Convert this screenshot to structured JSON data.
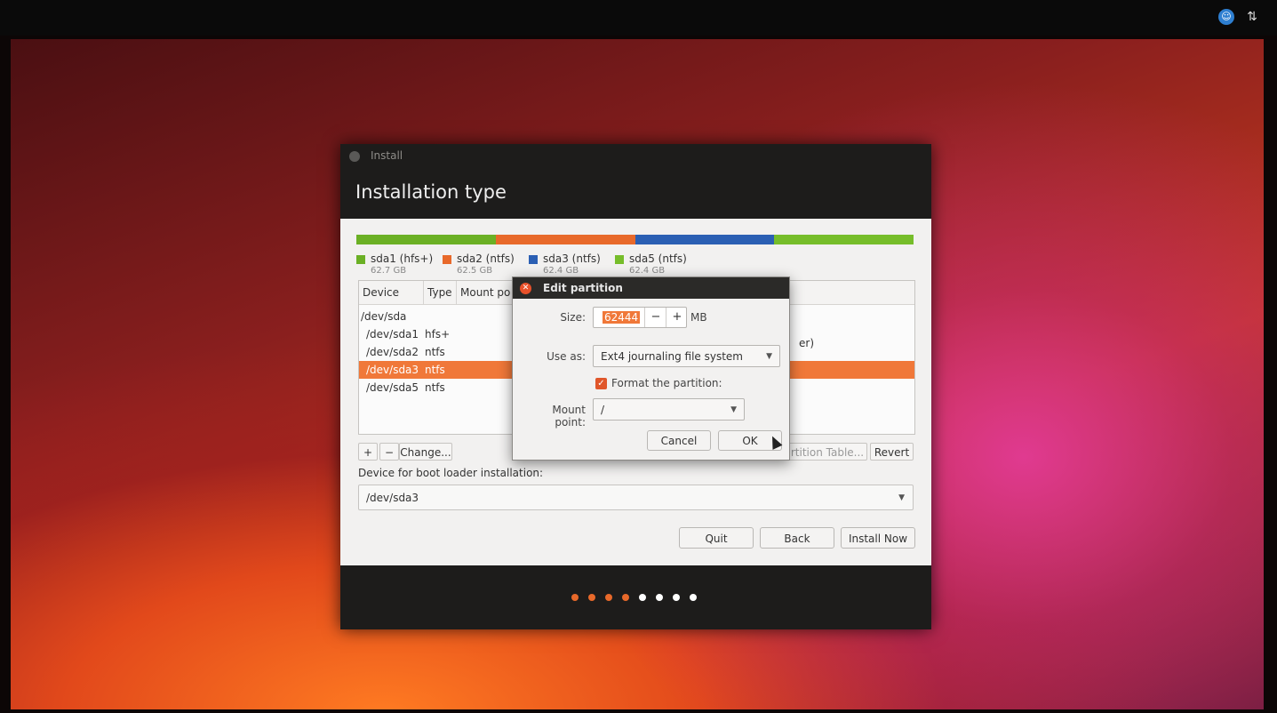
{
  "window": {
    "title": "Install",
    "page_title": "Installation type"
  },
  "partitions_bar": [
    {
      "name": "sda1 (hfs+)",
      "size": "62.7 GB",
      "color": "#6bb025"
    },
    {
      "name": "sda2 (ntfs)",
      "size": "62.5 GB",
      "color": "#e8692a"
    },
    {
      "name": "sda3 (ntfs)",
      "size": "62.4 GB",
      "color": "#2b5fb3"
    },
    {
      "name": "sda5 (ntfs)",
      "size": "62.4 GB",
      "color": "#76bd2a"
    }
  ],
  "table": {
    "headers": [
      "Device",
      "Type",
      "Mount po"
    ],
    "rows": [
      {
        "device": "/dev/sda",
        "type": ""
      },
      {
        "device": "/dev/sda1",
        "type": "hfs+"
      },
      {
        "device": "/dev/sda2",
        "type": "ntfs"
      },
      {
        "device": "/dev/sda3",
        "type": "ntfs",
        "selected": true
      },
      {
        "device": "/dev/sda5",
        "type": "ntfs"
      }
    ],
    "partial_text": "er)"
  },
  "table_buttons": {
    "add": "+",
    "remove": "−",
    "change": "Change...",
    "new_table": "rtition Table...",
    "revert": "Revert"
  },
  "boot_loader": {
    "label": "Device for boot loader installation:",
    "value": "/dev/sda3"
  },
  "buttons": {
    "quit": "Quit",
    "back": "Back",
    "install": "Install Now"
  },
  "progress_dots": {
    "total": 8,
    "done": 4,
    "done_color": "#e8692a",
    "todo_color": "#ffffff"
  },
  "dialog": {
    "title": "Edit partition",
    "size_label": "Size:",
    "size_value": "62444",
    "size_unit": "MB",
    "minus": "−",
    "plus": "+",
    "use_as_label": "Use as:",
    "use_as_value": "Ext4 journaling file system",
    "format_label": "Format the partition:",
    "format_checked": true,
    "mount_label": "Mount point:",
    "mount_value": "/",
    "cancel": "Cancel",
    "ok": "OK"
  }
}
